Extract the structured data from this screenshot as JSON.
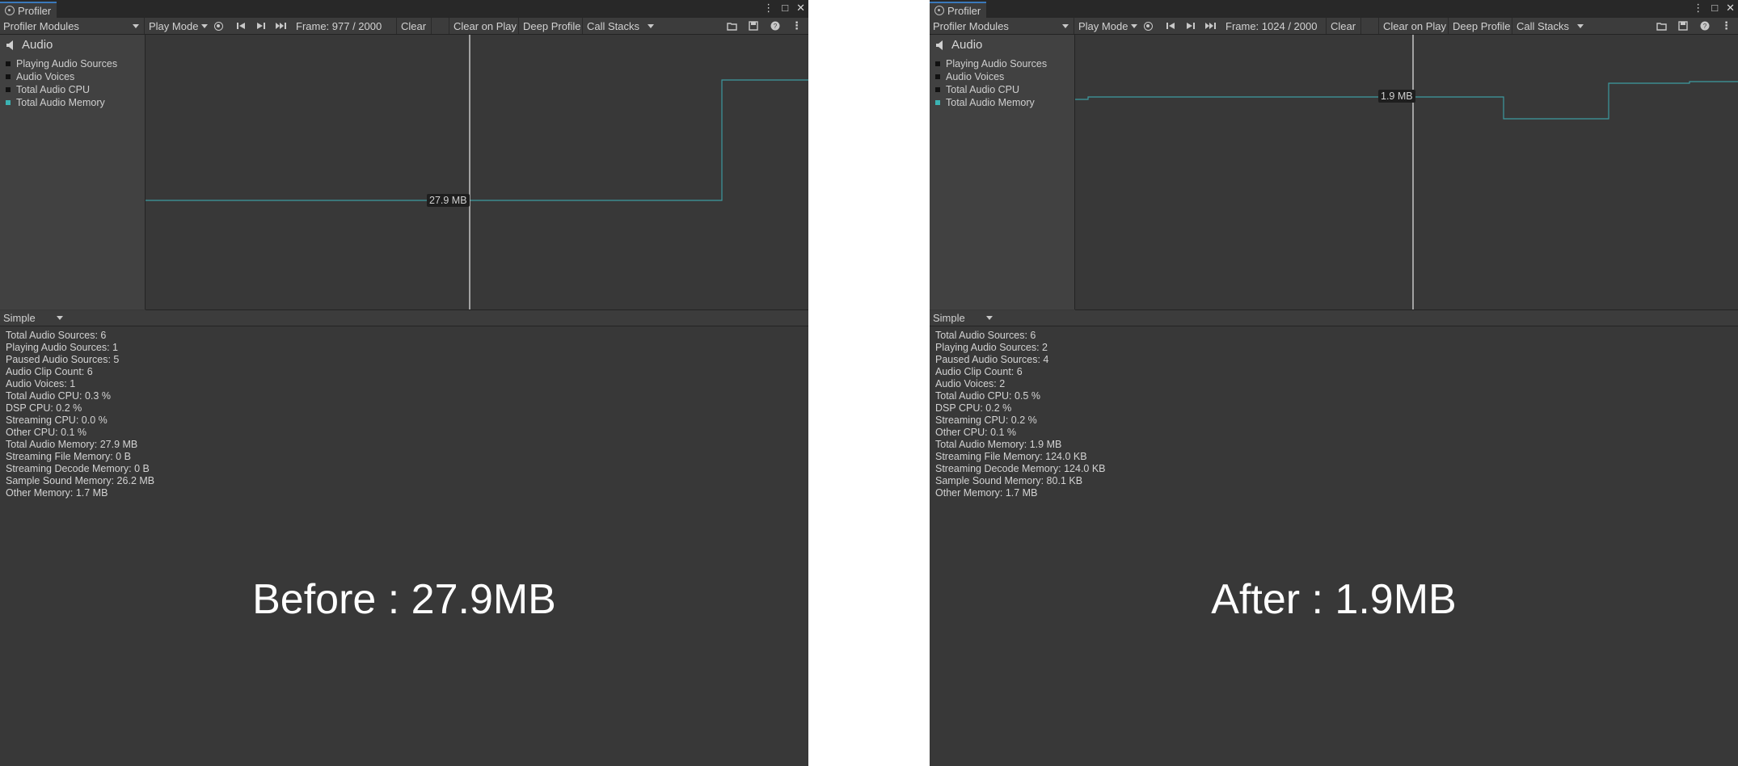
{
  "window": {
    "title": "Profiler",
    "window_controls": [
      "⋮",
      "□",
      "✕"
    ]
  },
  "toolbar": {
    "modules_label": "Profiler Modules",
    "play_mode_label": "Play Mode",
    "clear_label": "Clear",
    "clear_on_play_label": "Clear on Play",
    "deep_profile_label": "Deep Profile",
    "call_stacks_label": "Call Stacks",
    "icons": [
      "record-icon",
      "step-back-icon",
      "step-forward-icon",
      "jump-to-end-icon",
      "load-icon",
      "save-icon",
      "help-icon",
      "more-icon"
    ]
  },
  "module": {
    "name": "Audio",
    "legend": [
      "Playing Audio Sources",
      "Audio Voices",
      "Total Audio CPU",
      "Total Audio Memory"
    ],
    "active_legend_color": "#3bb3b3"
  },
  "view_mode": "Simple",
  "panels": [
    {
      "frame": "Frame: 977 / 2000",
      "value_label": "27.9 MB",
      "stats": [
        "Total Audio Sources: 6",
        "Playing Audio Sources: 1",
        "Paused Audio Sources: 5",
        "Audio Clip Count: 6",
        "Audio Voices: 1",
        "Total Audio CPU: 0.3 %",
        "DSP CPU: 0.2 %",
        "Streaming CPU: 0.0 %",
        "Other CPU: 0.1 %",
        "Total Audio Memory: 27.9 MB",
        "Streaming File Memory: 0 B",
        "Streaming Decode Memory: 0 B",
        "Sample Sound Memory: 26.2 MB",
        "Other Memory: 1.7 MB"
      ],
      "caption": "Before : 27.9MB"
    },
    {
      "frame": "Frame: 1024 / 2000",
      "value_label": "1.9 MB",
      "stats": [
        "Total Audio Sources: 6",
        "Playing Audio Sources: 2",
        "Paused Audio Sources: 4",
        "Audio Clip Count: 6",
        "Audio Voices: 2",
        "Total Audio CPU: 0.5 %",
        "DSP CPU: 0.2 %",
        "Streaming CPU: 0.2 %",
        "Other CPU: 0.1 %",
        "Total Audio Memory: 1.9 MB",
        "Streaming File Memory: 124.0 KB",
        "Streaming Decode Memory: 124.0 KB",
        "Sample Sound Memory: 80.1 KB",
        "Other Memory: 1.7 MB"
      ],
      "caption": "After : 1.9MB"
    }
  ]
}
